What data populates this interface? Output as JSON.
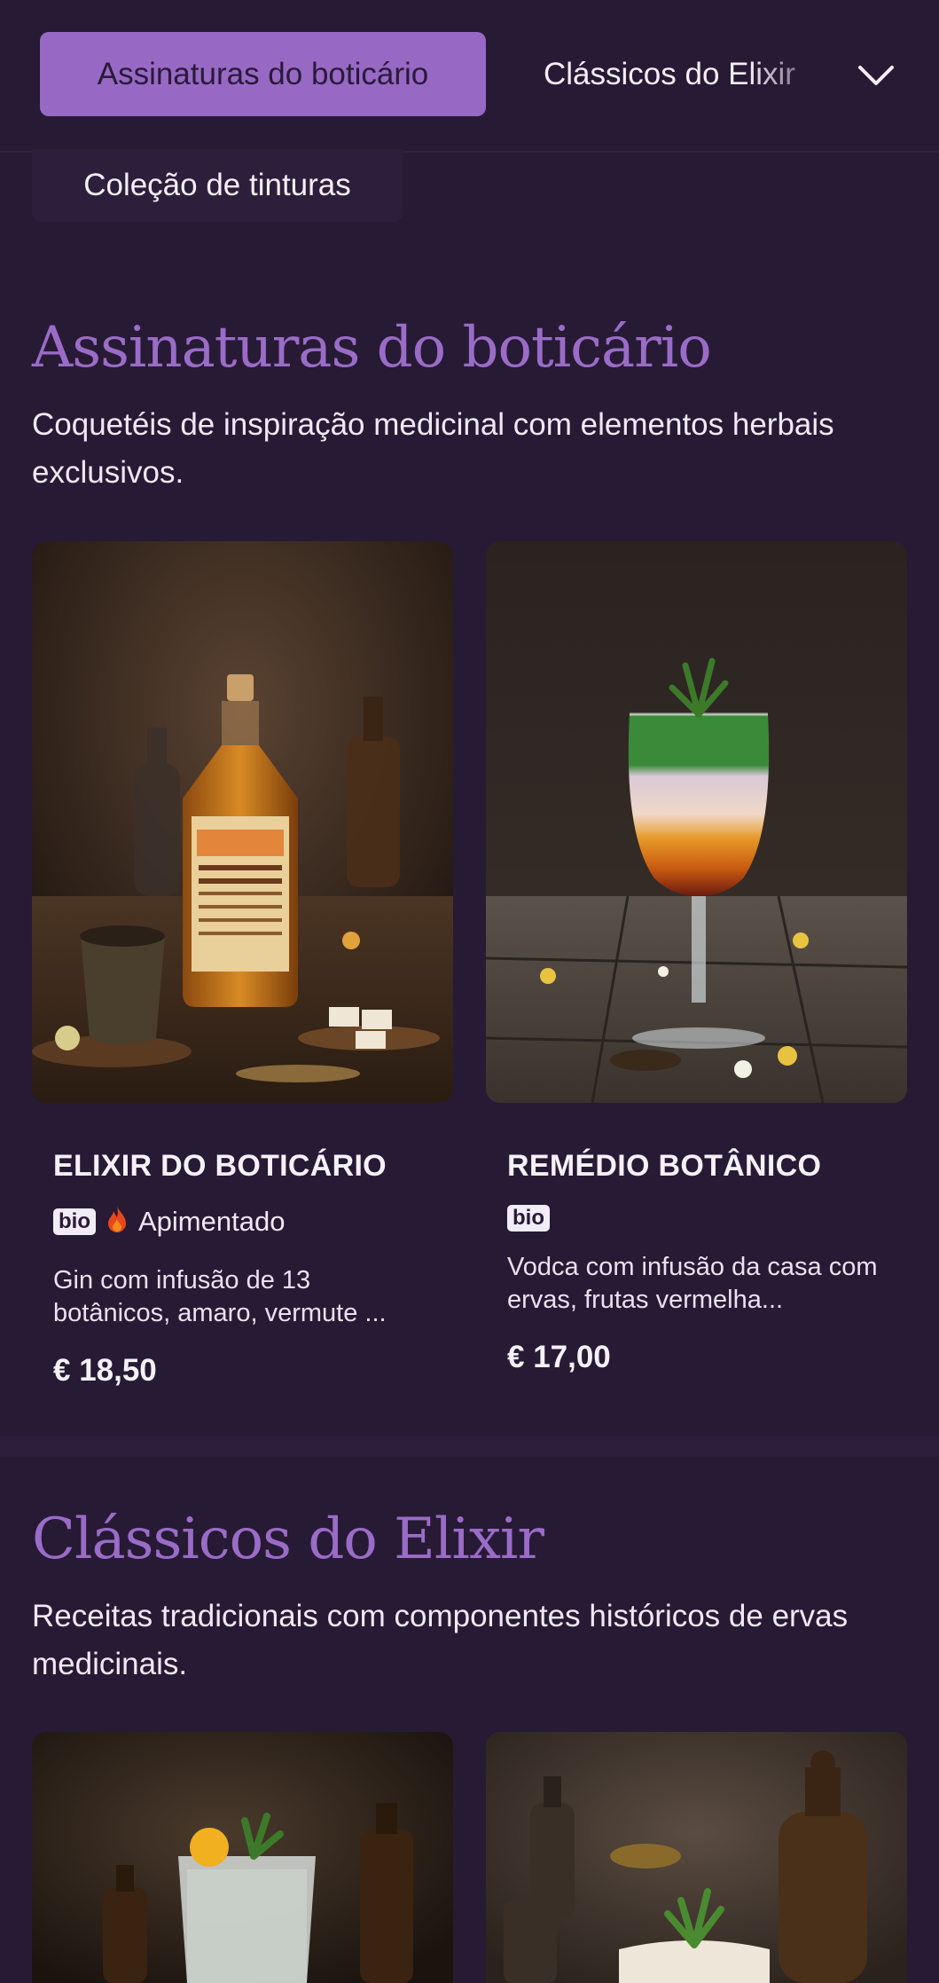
{
  "nav": {
    "active_tab": "Assinaturas do boticário",
    "next_tab": "Clássicos do Elixir",
    "secondary_tab": "Coleção de tinturas",
    "chevron_icon": "chevron-down-icon"
  },
  "sections": [
    {
      "title": "Assinaturas do boticário",
      "description": "Coquetéis de inspiração medicinal com elementos herbais exclusivos.",
      "items": [
        {
          "name": "ELIXIR DO BOTICÁRIO",
          "badge": "bio",
          "tag": "Apimentado",
          "tag_icon": "flame-icon",
          "description": "Gin com infusão de 13 botânicos, amaro, vermute ...",
          "price": "€ 18,50"
        },
        {
          "name": "REMÉDIO BOTÂNICO",
          "badge": "bio",
          "description": "Vodca com infusão da casa com ervas, frutas vermelha...",
          "price": "€ 17,00"
        }
      ]
    },
    {
      "title": "Clássicos do Elixir",
      "description": "Receitas tradicionais com componentes históricos de ervas medicinais."
    }
  ],
  "colors": {
    "background": "#271a35",
    "accent": "#9769c4",
    "heading": "#9a6cc7"
  }
}
